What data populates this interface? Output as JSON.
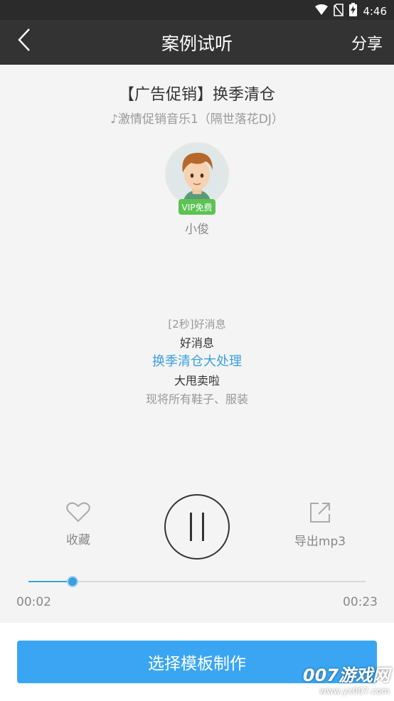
{
  "status_bar": {
    "time": "4:46",
    "icons": [
      "wifi-icon",
      "no-sim-icon",
      "battery-charging-icon"
    ]
  },
  "app_bar": {
    "back_icon": "chevron-left-icon",
    "title": "案例试听",
    "share_label": "分享"
  },
  "song": {
    "title": "【广告促销】换季清仓",
    "subtitle": "♪激情促销音乐1（隔世落花DJ）"
  },
  "singer": {
    "badge": "VIP免费",
    "name": "小俊"
  },
  "lyrics": [
    "[2秒]好消息",
    "好消息",
    "换季清仓大处理",
    "大甩卖啦",
    "现将所有鞋子、服装"
  ],
  "controls": {
    "favorite_icon": "heart-icon",
    "favorite_label": "收藏",
    "play_state": "paused-icon",
    "export_icon": "share-out-icon",
    "export_label": "导出mp3"
  },
  "progress": {
    "current_time": "00:02",
    "total_time": "00:23",
    "fraction": 0.13,
    "accent_color": "#3a9fe0"
  },
  "action": {
    "make_label": "选择模板制作",
    "button_color": "#3aa6f3"
  },
  "watermark": {
    "brand": "007游戏网",
    "url": "www.yx007.com"
  }
}
